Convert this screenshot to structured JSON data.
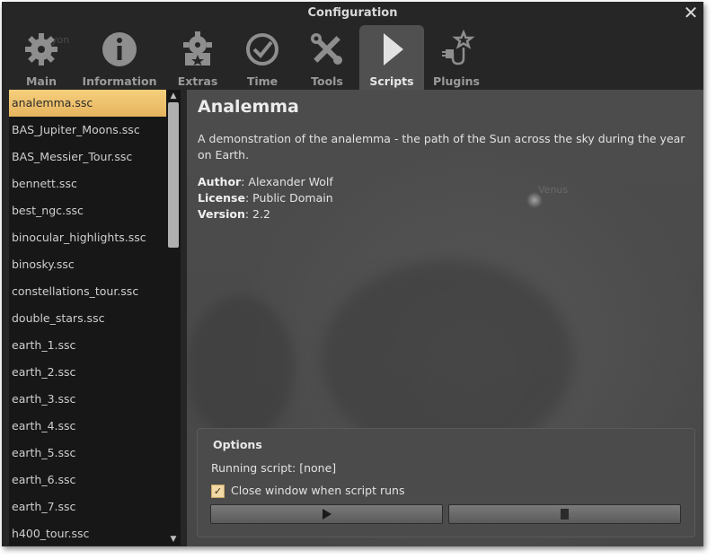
{
  "window": {
    "title": "Configuration"
  },
  "background_text": {
    "ghost": "cyon",
    "sky_label": "Venus"
  },
  "tabs": [
    {
      "label": "Main",
      "icon": "gear-icon"
    },
    {
      "label": "Information",
      "icon": "info-icon"
    },
    {
      "label": "Extras",
      "icon": "extras-icon"
    },
    {
      "label": "Time",
      "icon": "clock-icon"
    },
    {
      "label": "Tools",
      "icon": "tools-icon"
    },
    {
      "label": "Scripts",
      "icon": "play-icon",
      "active": true
    },
    {
      "label": "Plugins",
      "icon": "plugin-icon"
    }
  ],
  "scripts": [
    "analemma.ssc",
    "BAS_Jupiter_Moons.ssc",
    "BAS_Messier_Tour.ssc",
    "bennett.ssc",
    "best_ngc.ssc",
    "binocular_highlights.ssc",
    "binosky.ssc",
    "constellations_tour.ssc",
    "double_stars.ssc",
    "earth_1.ssc",
    "earth_2.ssc",
    "earth_3.ssc",
    "earth_4.ssc",
    "earth_5.ssc",
    "earth_6.ssc",
    "earth_7.ssc",
    "h400_tour.ssc"
  ],
  "selected_script": "analemma.ssc",
  "details": {
    "title": "Analemma",
    "description": "A demonstration of the analemma - the path of the Sun across the sky during the year on Earth.",
    "author_label": "Author",
    "author": ": Alexander Wolf",
    "license_label": "License",
    "license": ": Public Domain",
    "version_label": "Version",
    "version": ": 2.2"
  },
  "options": {
    "title": "Options",
    "running": "Running script: [none]",
    "close_label": "Close window when script runs",
    "close_checked": true
  },
  "colors": {
    "selection": "#f0c46e",
    "window_bg": "#262626",
    "active_tab": "#505050"
  }
}
